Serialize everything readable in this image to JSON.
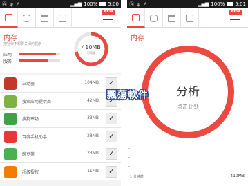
{
  "status_bar": {
    "left_icons": "Ⓐ ψ ⚡",
    "time": "5:00",
    "right_time": "5:01",
    "battery": "100%",
    "signal": "📶"
  },
  "tabs": [
    "memory-tab",
    "storage-tab",
    "trash-tab",
    "app-tab"
  ],
  "gift_badge": "NEW",
  "colors": {
    "accent": "#e8483f",
    "ring": "#ea4a3f",
    "check_bg": "#ececec"
  },
  "memory": {
    "title": "内存",
    "subtitle": "按钮你不想要关闭的程序",
    "legend_app": "应用",
    "legend_service": "服务",
    "app_fraction": 0.9,
    "service_fraction": 0.7,
    "total": "410MB",
    "total_unit": "可用量",
    "used_fraction": 0.72
  },
  "apps": [
    {
      "name": "启动器",
      "size": "104MB",
      "icon": "home-icon",
      "color": "#c0392b"
    },
    {
      "name": "搜索应用提供商",
      "size": "42MB",
      "icon": "android-icon",
      "color": "#7cb342"
    },
    {
      "name": "搜狗市场",
      "size": "33MB",
      "icon": "market-icon",
      "color": "#43a047"
    },
    {
      "name": "百度手机助手",
      "size": "28MB",
      "icon": "baidu-icon",
      "color": "#e53935"
    },
    {
      "name": "豌豆荚",
      "size": "23MB",
      "icon": "pea-icon",
      "color": "#4caf50"
    },
    {
      "name": "超级授权",
      "size": "11MB",
      "icon": "superuser-icon",
      "color": "#f57c00"
    }
  ],
  "analyze": {
    "title": "内存",
    "button": "分析",
    "sub": "点击此处",
    "foot_left": "1 分钟前",
    "foot_right": "410MB"
  },
  "watermark": "飄蕩軟件"
}
